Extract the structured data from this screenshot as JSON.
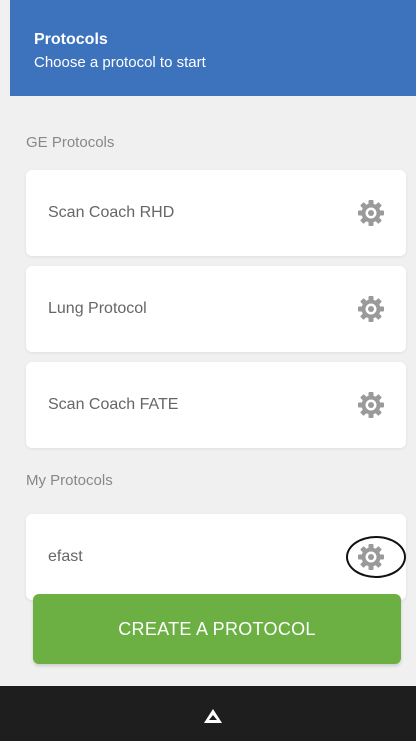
{
  "header": {
    "title": "Protocols",
    "subtitle": "Choose a protocol to start",
    "background_color": "#3d73bd"
  },
  "sections": [
    {
      "label": "GE Protocols",
      "items": [
        {
          "name": "Scan Coach RHD",
          "icon": "gear-icon"
        },
        {
          "name": "Lung Protocol",
          "icon": "gear-icon"
        },
        {
          "name": "Scan Coach FATE",
          "icon": "gear-icon"
        }
      ]
    },
    {
      "label": "My Protocols",
      "items": [
        {
          "name": "efast",
          "icon": "gear-icon",
          "highlighted": true
        }
      ]
    }
  ],
  "create_button": {
    "label": "CREATE A PROTOCOL",
    "color": "#6cb044"
  },
  "nav_bar": {
    "icon": "up-arrow-icon",
    "background_color": "#1e1e1e"
  }
}
